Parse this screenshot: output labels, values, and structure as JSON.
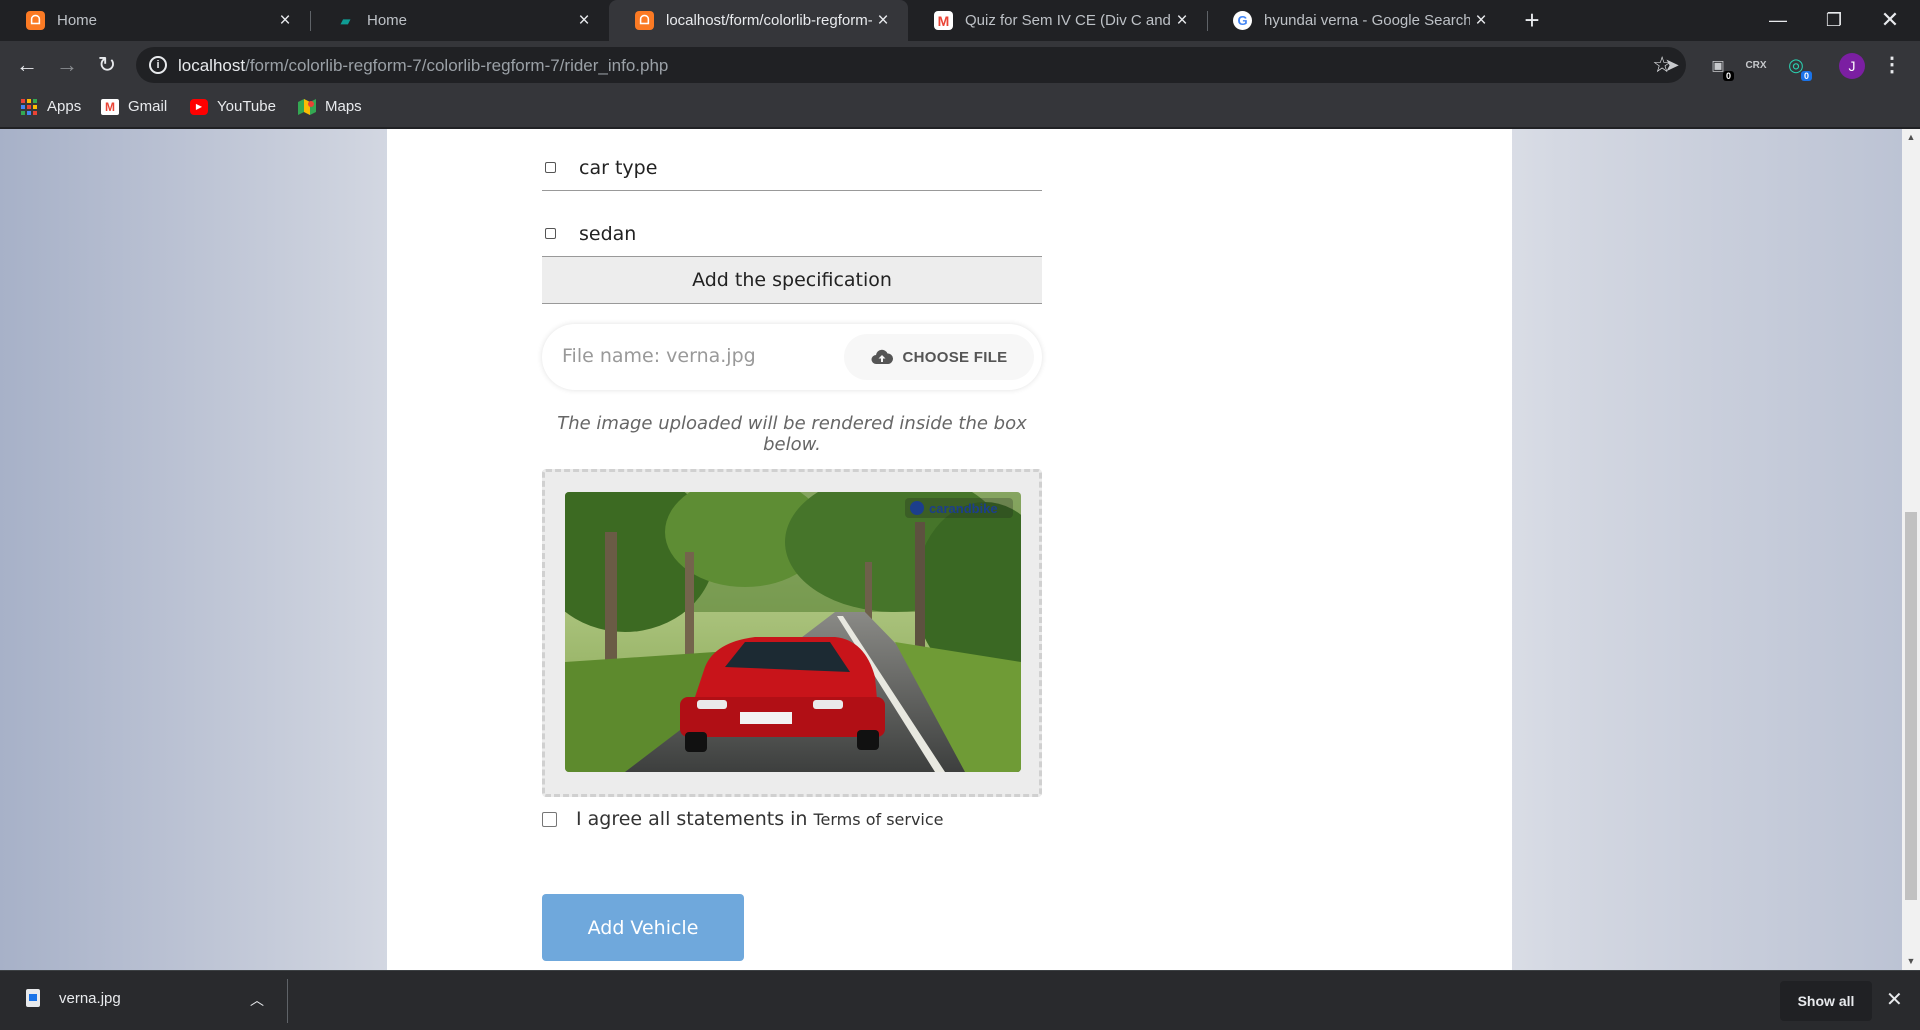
{
  "browser": {
    "tabs": [
      {
        "title": "Home",
        "favicon": "xampp-icon",
        "favicon_color": "#fb7a24",
        "active": false
      },
      {
        "title": "Home",
        "favicon": "web-icon",
        "favicon_color": "#0f9d95",
        "active": false
      },
      {
        "title": "localhost/form/colorlib-regform-",
        "favicon": "xampp-icon",
        "favicon_color": "#fb7a24",
        "active": true
      },
      {
        "title": "Quiz for Sem IV CE (Div C and D)",
        "favicon": "gmail-icon",
        "favicon_color": "#ea4335",
        "active": false
      },
      {
        "title": "hyundai verna - Google Search",
        "favicon": "google-icon",
        "favicon_color": "#4285f4",
        "active": false
      }
    ],
    "new_tab_symbol": "+",
    "url": {
      "host": "localhost",
      "path": "/form/colorlib-regform-7/colorlib-regform-7/rider_info.php"
    },
    "profile_initial": "J",
    "extension_badges": {
      "first": "0",
      "second": "0"
    },
    "extension_text": "CRX",
    "bookmarks": [
      {
        "label": "Apps",
        "icon": "apps-grid-icon"
      },
      {
        "label": "Gmail",
        "icon": "gmail-icon"
      },
      {
        "label": "YouTube",
        "icon": "youtube-icon"
      },
      {
        "label": "Maps",
        "icon": "maps-icon"
      }
    ]
  },
  "form": {
    "spec_rows": [
      {
        "label": "car type"
      },
      {
        "label": "sedan"
      }
    ],
    "add_spec_label": "Add the specification",
    "file_name_text": "File name: verna.jpg",
    "choose_file_label": "CHOOSE FILE",
    "hint_text": "The image uploaded will be rendered inside the box below.",
    "photo_watermark": "carandbike",
    "agree_text": "I agree all statements in",
    "tos_link": "Terms of service",
    "submit_label": "Add Vehicle"
  },
  "downloads": {
    "file_name": "verna.jpg",
    "show_all_label": "Show all"
  },
  "colors": {
    "accent_button": "#6fa8dc",
    "card_bg": "#ffffff",
    "chrome_dark": "#202124",
    "chrome_toolbar": "#35363a"
  }
}
